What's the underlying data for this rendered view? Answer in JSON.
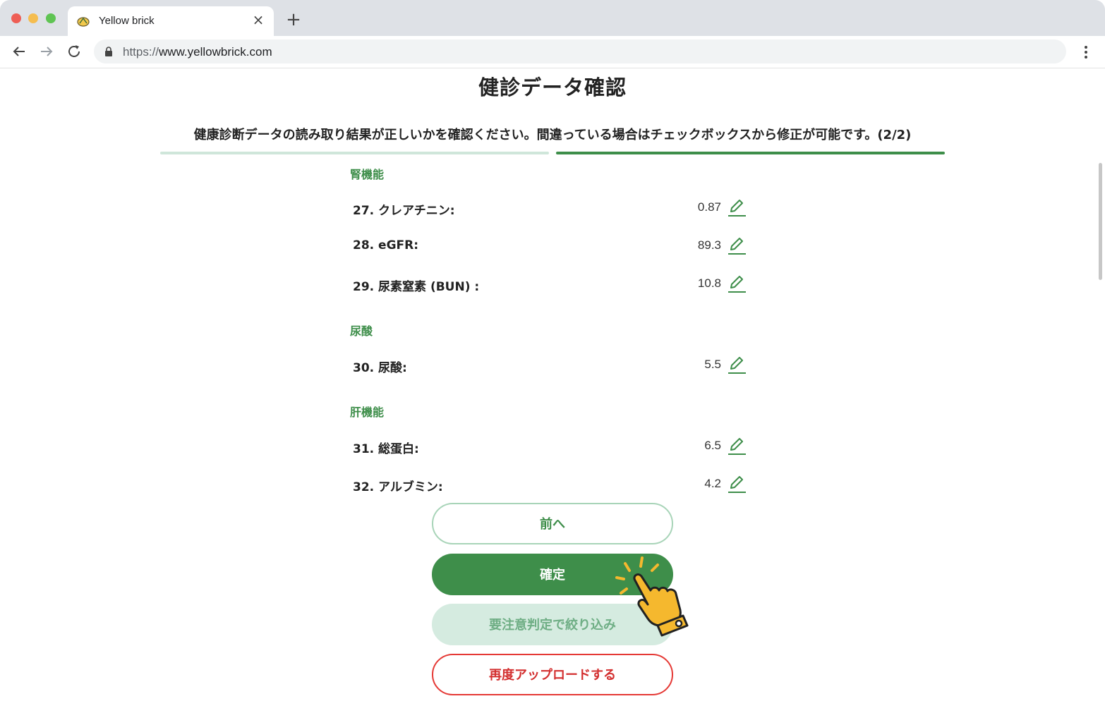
{
  "browser": {
    "tab_title": "Yellow brick",
    "url_scheme": "https://",
    "url_host": "www.yellowbrick.com"
  },
  "page": {
    "title": "健診データ確認",
    "instruction": "健康診断データの読み取り結果が正しいかを確認ください。間違っている場合はチェックボックスから修正が可能です。(2/2)",
    "progress": {
      "current_step": 2,
      "total_steps": 2
    }
  },
  "sections": [
    {
      "title": "腎機能",
      "items": [
        {
          "label": "27. クレアチニン:",
          "value": "0.87"
        },
        {
          "label": "28. eGFR:",
          "value": "89.3"
        },
        {
          "label": "29. 尿素窒素 (BUN) :",
          "value": "10.8"
        }
      ]
    },
    {
      "title": "尿酸",
      "items": [
        {
          "label": "30. 尿酸:",
          "value": "5.5"
        }
      ]
    },
    {
      "title": "肝機能",
      "items": [
        {
          "label": "31. 総蛋白:",
          "value": "6.5"
        },
        {
          "label": "32. アルブミン:",
          "value": "4.2"
        }
      ]
    }
  ],
  "buttons": {
    "prev": "前へ",
    "confirm": "確定",
    "filter": "要注意判定で絞り込み",
    "reupload": "再度アップロードする"
  },
  "colors": {
    "accent_green": "#3e8e4a",
    "light_green": "#d5ebe0",
    "danger_red": "#e53935",
    "hand_yellow": "#f5b82e"
  },
  "icons": {
    "edit": "pencil-icon",
    "pointer": "pointing-hand-icon"
  }
}
